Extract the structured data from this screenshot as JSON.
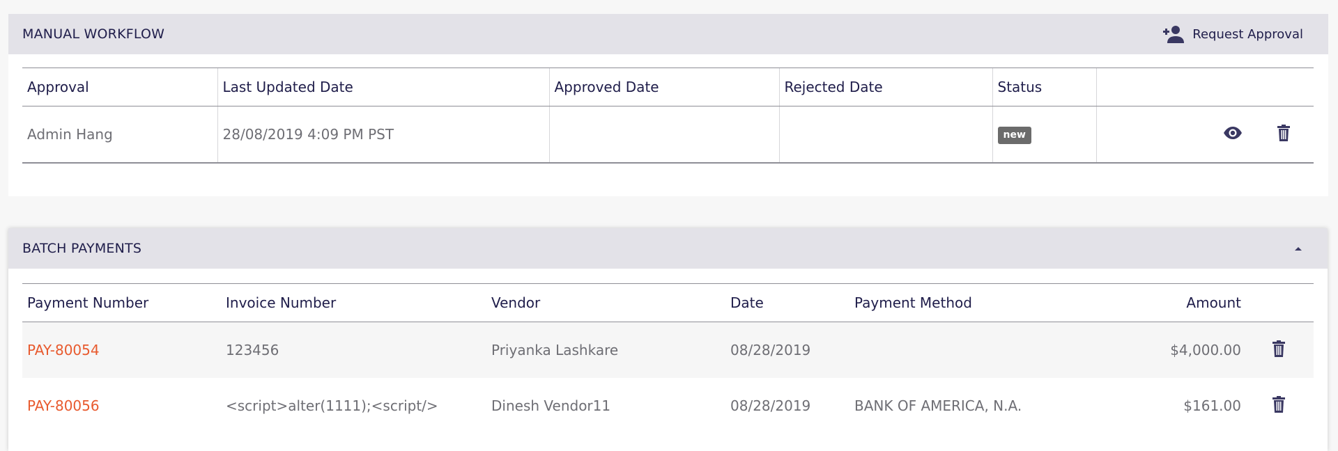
{
  "workflow": {
    "title": "MANUAL WORKFLOW",
    "request_label": "Request Approval",
    "columns": [
      "Approval",
      "Last Updated Date",
      "Approved Date",
      "Rejected Date",
      "Status",
      ""
    ],
    "rows": [
      {
        "approval": "Admin Hang",
        "last_updated": "28/08/2019 4:09 PM PST",
        "approved": "",
        "rejected": "",
        "status": "new"
      }
    ]
  },
  "batch": {
    "title": "BATCH PAYMENTS",
    "columns": [
      "Payment Number",
      "Invoice Number",
      "Vendor",
      "Date",
      "Payment Method",
      "Amount",
      ""
    ],
    "rows": [
      {
        "payment_number": "PAY-80054",
        "invoice_number": "123456",
        "vendor": "Priyanka Lashkare",
        "date": "08/28/2019",
        "payment_method": "",
        "amount": "$4,000.00"
      },
      {
        "payment_number": "PAY-80056",
        "invoice_number": "<script>alter(1111);<script/>",
        "vendor": "Dinesh Vendor11",
        "date": "08/28/2019",
        "payment_method": "BANK OF AMERICA, N.A.",
        "amount": "$161.00"
      }
    ]
  },
  "icons": {
    "request": "person-add-icon",
    "view": "eye-icon",
    "delete": "trash-icon",
    "collapse": "caret-up-icon"
  },
  "colors": {
    "header_bg": "#e3e2e8",
    "text_dark": "#1f1d4a",
    "text_muted": "#6e6e74",
    "link": "#e85a2e",
    "badge_bg": "#6b6b6b"
  }
}
